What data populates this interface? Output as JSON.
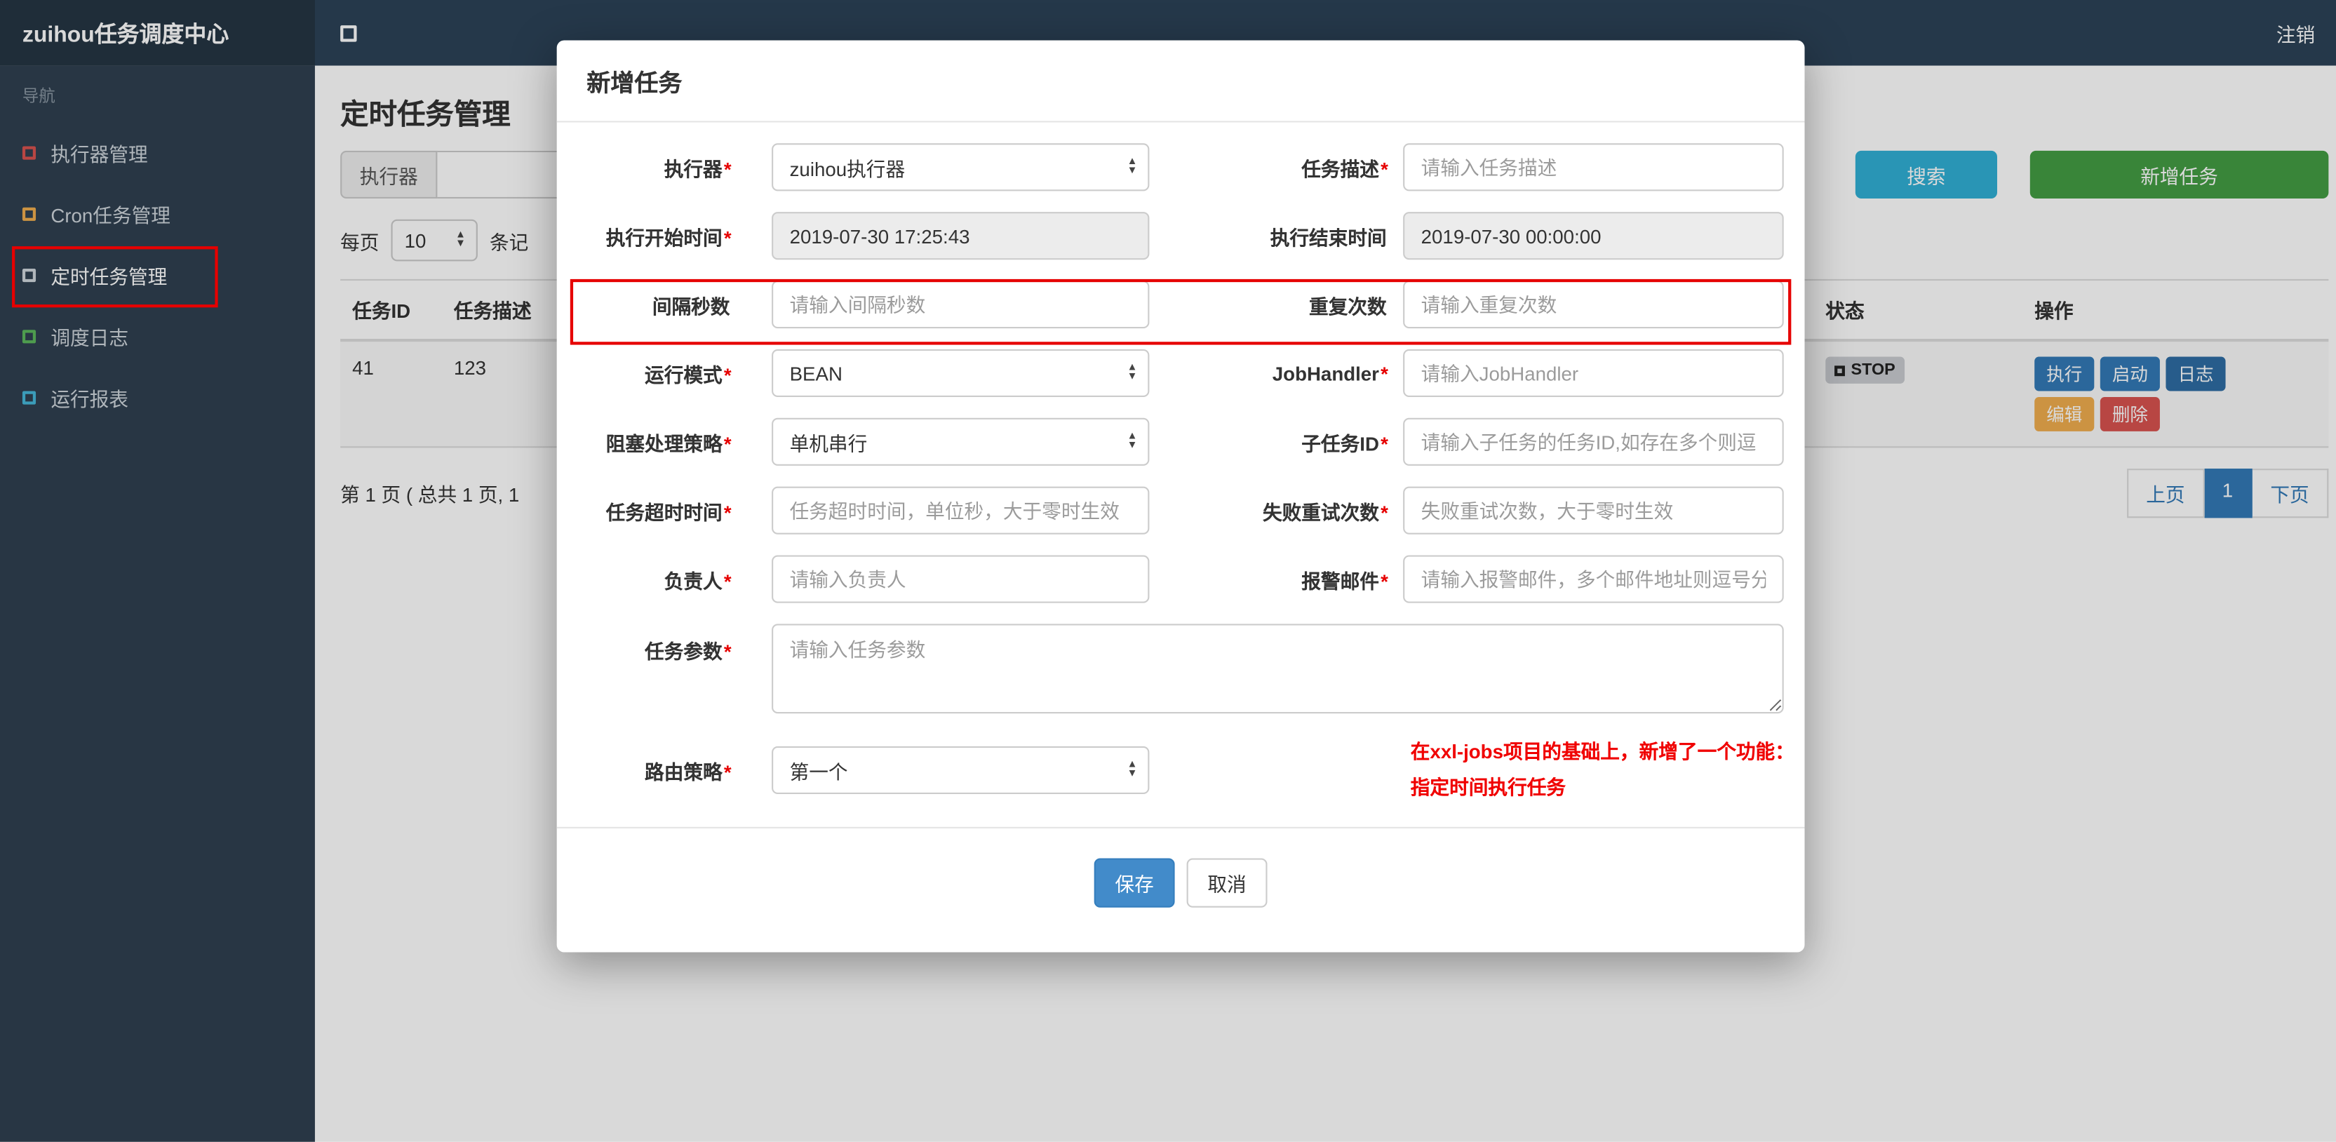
{
  "colors": {
    "navbar_bg": "#2c4257",
    "brand_bg": "#253544",
    "sidebar_bg": "#2f4050",
    "search_button": "#31b0d5",
    "add_button": "#449d44",
    "save_button": "#428bca",
    "primary_action": "#337ab7",
    "log_action": "#2e6da4",
    "edit_action": "#f0ad4e",
    "delete_action": "#d9534f",
    "status_badge_bg": "#c9ccd1",
    "annotation_red": "#e60000",
    "note_red": "#f00000",
    "active_page_bg": "#337ab7"
  },
  "navbar": {
    "brand": "zuihou任务调度中心",
    "logout": "注销"
  },
  "sidebar": {
    "header": "导航",
    "items": [
      {
        "label": "执行器管理",
        "icon": "square-icon",
        "icon_color": "#d9534f"
      },
      {
        "label": "Cron任务管理",
        "icon": "square-icon",
        "icon_color": "#f0ad4e"
      },
      {
        "label": "定时任务管理",
        "icon": "square-icon",
        "icon_color": "#cfd6dc",
        "annotated": true
      },
      {
        "label": "调度日志",
        "icon": "square-icon",
        "icon_color": "#5cb85c"
      },
      {
        "label": "运行报表",
        "icon": "square-icon",
        "icon_color": "#46b8da"
      }
    ]
  },
  "page": {
    "title": "定时任务管理",
    "toolbar": {
      "filter_label": "执行器",
      "search": "搜索",
      "add": "新增任务"
    },
    "perpage": {
      "prefix": "每页",
      "value": "10",
      "suffix": "条记"
    },
    "table": {
      "headers": [
        "任务ID",
        "任务描述",
        "状态",
        "操作"
      ],
      "rows": [
        {
          "id": "41",
          "desc": "123",
          "status": "STOP",
          "actions": [
            "执行",
            "启动",
            "日志",
            "编辑",
            "删除"
          ]
        }
      ]
    },
    "pagination": {
      "info": "第 1 页 ( 总共 1 页, 1",
      "prev": "上页",
      "current": "1",
      "next": "下页"
    }
  },
  "modal": {
    "title": "新增任务",
    "rows": [
      {
        "left": {
          "label": "执行器",
          "req": "*",
          "type": "select",
          "value": "zuihou执行器"
        },
        "right": {
          "label": "任务描述",
          "req": "*",
          "type": "input",
          "placeholder": "请输入任务描述"
        }
      },
      {
        "left": {
          "label": "执行开始时间",
          "req": "*",
          "type": "readonly",
          "value": "2019-07-30 17:25:43"
        },
        "right": {
          "label": "执行结束时间",
          "req": "",
          "type": "readonly",
          "value": "2019-07-30 00:00:00"
        }
      },
      {
        "left": {
          "label": "间隔秒数",
          "req": "",
          "type": "input",
          "placeholder": "请输入间隔秒数"
        },
        "right": {
          "label": "重复次数",
          "req": "",
          "type": "input",
          "placeholder": "请输入重复次数"
        }
      },
      {
        "left": {
          "label": "运行模式",
          "req": "*",
          "type": "select",
          "value": "BEAN"
        },
        "right": {
          "label": "JobHandler",
          "req": "*",
          "type": "input",
          "placeholder": "请输入JobHandler"
        }
      },
      {
        "left": {
          "label": "阻塞处理策略",
          "req": "*",
          "type": "select",
          "value": "单机串行"
        },
        "right": {
          "label": "子任务ID",
          "req": "*",
          "type": "input",
          "placeholder": "请输入子任务的任务ID,如存在多个则逗"
        }
      },
      {
        "left": {
          "label": "任务超时时间",
          "req": "*",
          "type": "input",
          "placeholder": "任务超时时间，单位秒，大于零时生效"
        },
        "right": {
          "label": "失败重试次数",
          "req": "*",
          "type": "input",
          "placeholder": "失败重试次数，大于零时生效"
        }
      },
      {
        "left": {
          "label": "负责人",
          "req": "*",
          "type": "input",
          "placeholder": "请输入负责人"
        },
        "right": {
          "label": "报警邮件",
          "req": "*",
          "type": "input",
          "placeholder": "请输入报警邮件，多个邮件地址则逗号分"
        }
      }
    ],
    "params": {
      "label": "任务参数",
      "req": "*",
      "placeholder": "请输入任务参数"
    },
    "route": {
      "label": "路由策略",
      "req": "*",
      "value": "第一个"
    },
    "note": {
      "line1": "在xxl-jobs项目的基础上，新增了一个功能：",
      "line2": "指定时间执行任务"
    },
    "footer": {
      "save": "保存",
      "cancel": "取消"
    }
  }
}
